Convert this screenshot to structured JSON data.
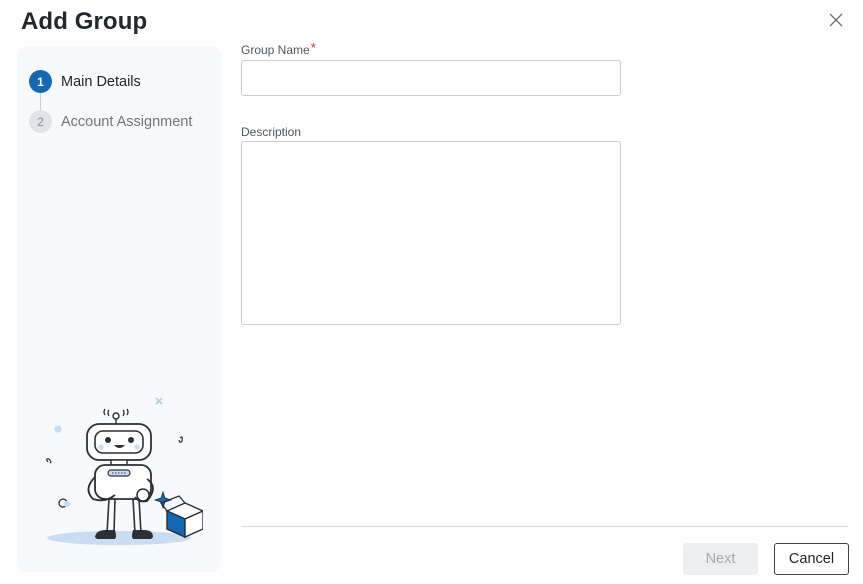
{
  "dialog": {
    "title": "Add Group"
  },
  "stepper": {
    "steps": [
      {
        "number": "1",
        "label": "Main Details",
        "state": "active"
      },
      {
        "number": "2",
        "label": "Account Assignment",
        "state": "inactive"
      }
    ]
  },
  "form": {
    "group_name": {
      "label": "Group Name",
      "required_marker": "*",
      "value": "",
      "placeholder": ""
    },
    "description": {
      "label": "Description",
      "value": "",
      "placeholder": ""
    }
  },
  "footer": {
    "next_label": "Next",
    "next_state": "disabled",
    "cancel_label": "Cancel"
  },
  "icons": {
    "close": "close-icon",
    "illustration": "robot-illustration"
  },
  "colors": {
    "accent": "#1268b3",
    "required": "#d62b2b",
    "panel_bg": "#f7f9fc"
  }
}
